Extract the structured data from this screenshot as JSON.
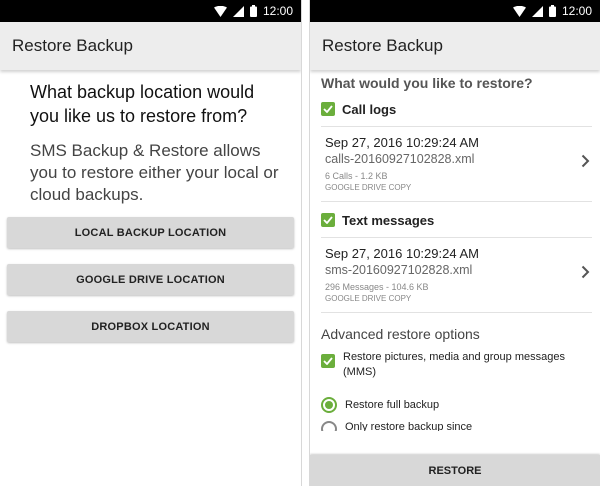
{
  "status_bar": {
    "time": "12:00"
  },
  "left": {
    "app_title": "Restore Backup",
    "question": "What backup location would you like us to restore from?",
    "description": "SMS Backup & Restore allows you to restore either your local or cloud backups.",
    "buttons": {
      "local": "LOCAL BACKUP LOCATION",
      "gdrive": "GOOGLE DRIVE LOCATION",
      "dropbox": "DROPBOX LOCATION"
    }
  },
  "right": {
    "app_title": "Restore Backup",
    "section_title": "What would you like to restore?",
    "call_logs": {
      "label": "Call logs",
      "checked": true,
      "date": "Sep 27, 2016 10:29:24 AM",
      "file": "calls-20160927102828.xml",
      "meta": "6 Calls - 1.2 KB",
      "copy": "GOOGLE DRIVE COPY"
    },
    "text_messages": {
      "label": "Text messages",
      "checked": true,
      "date": "Sep 27, 2016 10:29:24 AM",
      "file": "sms-20160927102828.xml",
      "meta": "296 Messages - 104.6 KB",
      "copy": "GOOGLE DRIVE COPY"
    },
    "advanced_title": "Advanced restore options",
    "mms_label": "Restore pictures, media and group messages (MMS)",
    "radio_full": "Restore full backup",
    "radio_partial": "Only restore backup since",
    "restore_button": "RESTORE"
  },
  "colors": {
    "accent_green": "#6bae3c",
    "appbar": "#ededed",
    "button": "#d8d8d8"
  }
}
